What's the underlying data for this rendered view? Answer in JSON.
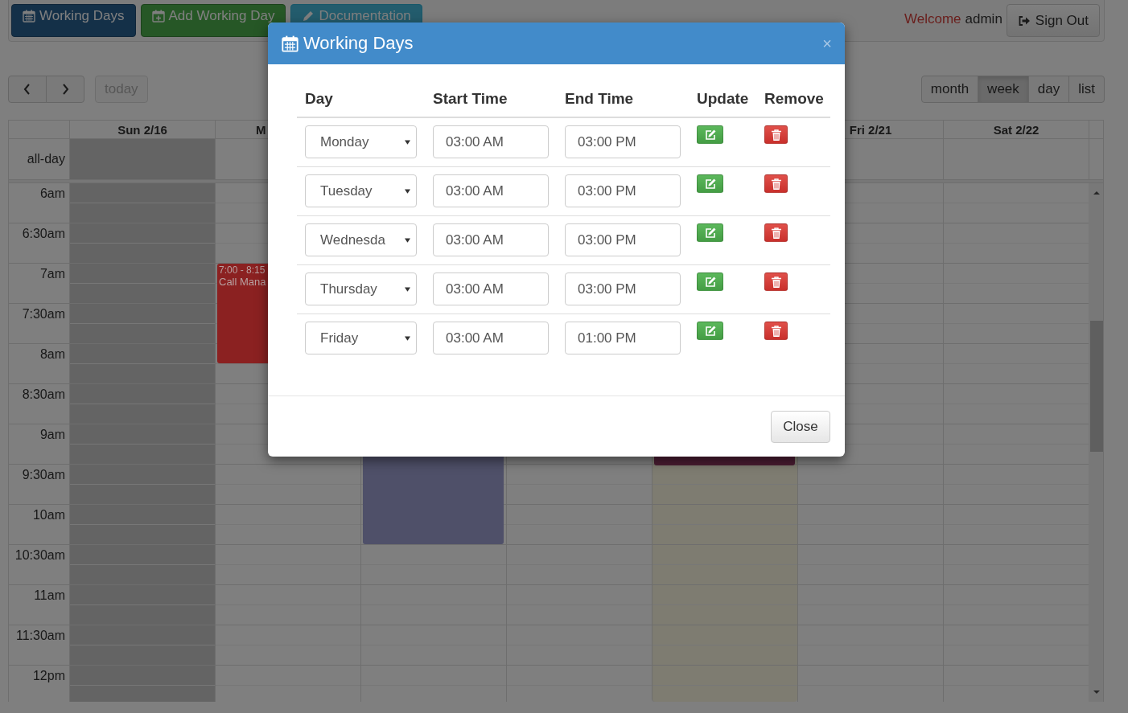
{
  "navbar": {
    "buttons": [
      {
        "label": "Working Days",
        "kind": "primary"
      },
      {
        "label": "Add Working Day",
        "kind": "success"
      },
      {
        "label": "Documentation",
        "kind": "info"
      }
    ],
    "welcome": "Welcome",
    "user": "admin",
    "sign_out": "Sign Out"
  },
  "toolbar": {
    "today": {
      "label": "today",
      "disabled": true
    },
    "views": [
      {
        "label": "month",
        "selected": false
      },
      {
        "label": "week",
        "selected": true
      },
      {
        "label": "day",
        "selected": false
      },
      {
        "label": "list",
        "selected": false
      }
    ]
  },
  "calendar": {
    "all_day_label": "all-day",
    "times": [
      "6am",
      "6:30am",
      "7am",
      "7:30am",
      "8am",
      "8:30am",
      "9am",
      "9:30am",
      "10am",
      "10:30am",
      "11am",
      "11:30am",
      "12pm"
    ],
    "days": [
      {
        "label": "Sun 2/16",
        "shaded": true,
        "today": false
      },
      {
        "label": "M",
        "shaded": false,
        "today": false,
        "events": [
          {
            "time": "7:00 - 8:15",
            "title": "Call Mana",
            "color": "#8b2121"
          }
        ]
      },
      {
        "shaded": false,
        "today": false,
        "events": [
          {
            "color": "#4f5069"
          }
        ]
      },
      {
        "shaded": false,
        "today": false
      },
      {
        "shaded": false,
        "today": true,
        "events": [
          {
            "color": "#4a1c32"
          }
        ]
      },
      {
        "label": "Fri 2/21",
        "shaded": false,
        "today": false
      },
      {
        "label": "Sat 2/22",
        "shaded": false,
        "today": false
      }
    ]
  },
  "modal": {
    "title": "Working Days",
    "close_symbol": "×",
    "columns": [
      "Day",
      "Start Time",
      "End Time",
      "Update",
      "Remove"
    ],
    "rows": [
      {
        "day": "Monday",
        "start": "03:00 AM",
        "end": "03:00 PM"
      },
      {
        "day": "Tuesday",
        "start": "03:00 AM",
        "end": "03:00 PM"
      },
      {
        "day": "Wednesda",
        "start": "03:00 AM",
        "end": "03:00 PM"
      },
      {
        "day": "Thursday",
        "start": "03:00 AM",
        "end": "03:00 PM"
      },
      {
        "day": "Friday",
        "start": "03:00 AM",
        "end": "01:00 PM"
      }
    ],
    "close_button": "Close"
  }
}
